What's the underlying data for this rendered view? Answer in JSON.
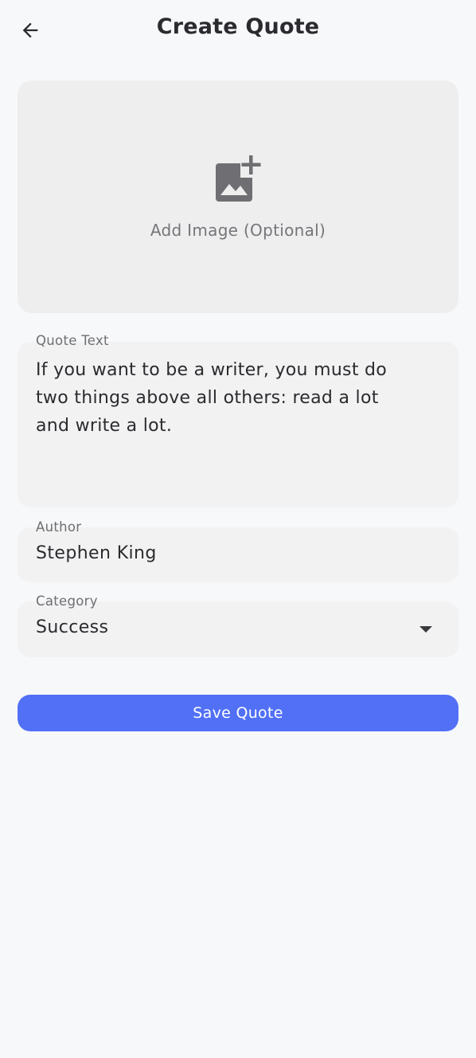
{
  "header": {
    "title": "Create Quote",
    "back_icon": "arrow-left-icon"
  },
  "image_picker": {
    "label": "Add Image (Optional)",
    "icon": "add-photo-icon"
  },
  "form": {
    "quote": {
      "label": "Quote Text",
      "value": "If you want to be a writer, you must do\ntwo things above all others: read a lot\nand write a lot."
    },
    "author": {
      "label": "Author",
      "value": "Stephen King"
    },
    "category": {
      "label": "Category",
      "selected": "Success",
      "icon": "caret-down-icon"
    }
  },
  "actions": {
    "save_label": "Save Quote"
  },
  "colors": {
    "background": "#F7F8FA",
    "primary": "#5170F5",
    "field_background": "#F2F2F3",
    "picker_background": "#EEEEEE",
    "text_primary": "#2B2B2F",
    "text_secondary": "#6E6E73"
  }
}
